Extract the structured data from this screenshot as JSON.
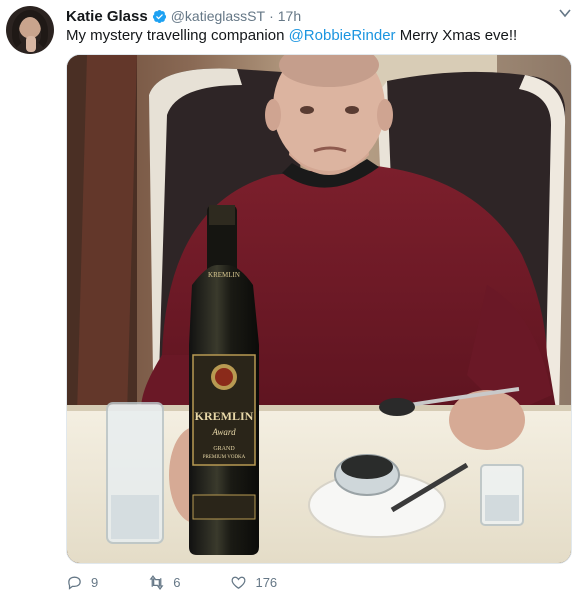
{
  "tweet": {
    "author_name": "Katie Glass",
    "author_handle": "@katieglassST",
    "separator": "·",
    "time": "17h",
    "text_before": "My mystery travelling companion ",
    "mention": "@RobbieRinder",
    "text_after": " Merry Xmas eve!!"
  },
  "photo": {
    "bottle_label": "KREMLIN",
    "bottle_sub": "Award",
    "bottle_grand": "GRAND",
    "bottle_premium": "PREMIUM VODKA"
  },
  "actions": {
    "replies": "9",
    "retweets": "6",
    "likes": "176"
  },
  "colors": {
    "accent": "#1b95e0",
    "text": "#14171a",
    "muted": "#657786"
  },
  "icons": {
    "verified": "verified-badge-icon",
    "reply": "reply-icon",
    "retweet": "retweet-icon",
    "like": "heart-icon",
    "menu": "chevron-down-icon"
  }
}
